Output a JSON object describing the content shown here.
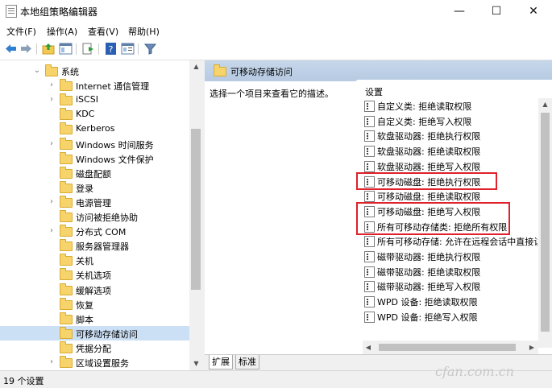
{
  "window": {
    "title": "本地组策略编辑器",
    "minimize": "—",
    "maximize": "☐",
    "close": "✕"
  },
  "menu": [
    "文件(F)",
    "操作(A)",
    "查看(V)",
    "帮助(H)"
  ],
  "toolbar": {
    "icons": [
      "back-icon",
      "forward-icon",
      "up-folder-icon",
      "show-hide-tree-icon",
      "export-icon",
      "help-icon",
      "properties-icon",
      "filter-icon"
    ]
  },
  "tree": {
    "items": [
      {
        "label": "系统",
        "indent": 1,
        "expander": "open"
      },
      {
        "label": "Internet 通信管理",
        "indent": 2,
        "expander": "closed"
      },
      {
        "label": "iSCSI",
        "indent": 2,
        "expander": "closed"
      },
      {
        "label": "KDC",
        "indent": 2,
        "expander": "none"
      },
      {
        "label": "Kerberos",
        "indent": 2,
        "expander": "none"
      },
      {
        "label": "Windows 时间服务",
        "indent": 2,
        "expander": "closed"
      },
      {
        "label": "Windows 文件保护",
        "indent": 2,
        "expander": "none"
      },
      {
        "label": "磁盘配额",
        "indent": 2,
        "expander": "none"
      },
      {
        "label": "登录",
        "indent": 2,
        "expander": "none"
      },
      {
        "label": "电源管理",
        "indent": 2,
        "expander": "closed"
      },
      {
        "label": "访问被拒绝协助",
        "indent": 2,
        "expander": "none"
      },
      {
        "label": "分布式 COM",
        "indent": 2,
        "expander": "closed"
      },
      {
        "label": "服务器管理器",
        "indent": 2,
        "expander": "none"
      },
      {
        "label": "关机",
        "indent": 2,
        "expander": "none"
      },
      {
        "label": "关机选项",
        "indent": 2,
        "expander": "none"
      },
      {
        "label": "缓解选项",
        "indent": 2,
        "expander": "none"
      },
      {
        "label": "恢复",
        "indent": 2,
        "expander": "none"
      },
      {
        "label": "脚本",
        "indent": 2,
        "expander": "none"
      },
      {
        "label": "可移动存储访问",
        "indent": 2,
        "expander": "none",
        "selected": true
      },
      {
        "label": "凭据分配",
        "indent": 2,
        "expander": "none"
      },
      {
        "label": "区域设置服务",
        "indent": 2,
        "expander": "closed"
      }
    ]
  },
  "right_pane": {
    "header_title": "可移动存储访问",
    "description": "选择一个项目来查看它的描述。",
    "settings_header": "设置",
    "settings": [
      {
        "label": "自定义类: 拒绝读取权限",
        "highlight": false
      },
      {
        "label": "自定义类: 拒绝写入权限",
        "highlight": false
      },
      {
        "label": "软盘驱动器: 拒绝执行权限",
        "highlight": false
      },
      {
        "label": "软盘驱动器: 拒绝读取权限",
        "highlight": false
      },
      {
        "label": "软盘驱动器: 拒绝写入权限",
        "highlight": false
      },
      {
        "label": "可移动磁盘: 拒绝执行权限",
        "highlight": true
      },
      {
        "label": "可移动磁盘: 拒绝读取权限",
        "highlight": false
      },
      {
        "label": "可移动磁盘: 拒绝写入权限",
        "highlight": true
      },
      {
        "label": "所有可移动存储类: 拒绝所有权限",
        "highlight": true
      },
      {
        "label": "所有可移动存储: 允许在远程会话中直接访问",
        "highlight": false
      },
      {
        "label": "磁带驱动器: 拒绝执行权限",
        "highlight": false
      },
      {
        "label": "磁带驱动器: 拒绝读取权限",
        "highlight": false
      },
      {
        "label": "磁带驱动器: 拒绝写入权限",
        "highlight": false
      },
      {
        "label": "WPD 设备: 拒绝读取权限",
        "highlight": false
      },
      {
        "label": "WPD 设备: 拒绝写入权限",
        "highlight": false
      }
    ],
    "tabs": [
      "扩展",
      "标准"
    ],
    "active_tab": "扩展"
  },
  "status": "19 个设置",
  "watermark": "cfan.com.cn",
  "colors": {
    "highlight_box": "#e0202a",
    "selection": "#cce0f5",
    "header": "#bfd1e8"
  }
}
